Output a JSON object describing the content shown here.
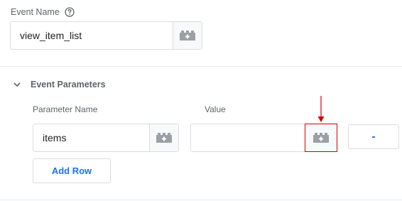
{
  "event_name": {
    "label": "Event Name",
    "value": "view_item_list",
    "help_icon": "question-circle-icon",
    "variable_icon": "lego-brick-icon"
  },
  "parameters": {
    "section_title": "Event Parameters",
    "expand_icon": "chevron-down-icon",
    "columns": {
      "name": "Parameter Name",
      "value": "Value"
    },
    "rows": [
      {
        "name": "items",
        "value": ""
      }
    ],
    "remove_label": "-",
    "add_row_label": "Add Row"
  },
  "colors": {
    "accent": "#1a73e8",
    "highlight": "#d50000",
    "border": "#dadce0",
    "icon": "#9aa0a6"
  }
}
